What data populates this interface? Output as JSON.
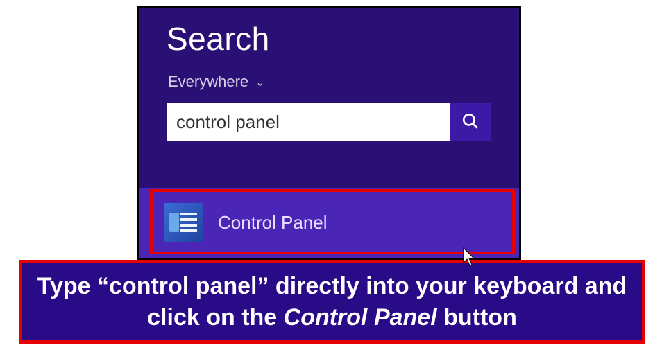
{
  "panel": {
    "title": "Search",
    "scope_label": "Everywhere",
    "input_value": "control panel"
  },
  "result": {
    "label": "Control Panel"
  },
  "instruction": {
    "pre": "Type “control panel” directly into your keyboard and click on the ",
    "em": "Control Panel",
    "post": " button"
  }
}
